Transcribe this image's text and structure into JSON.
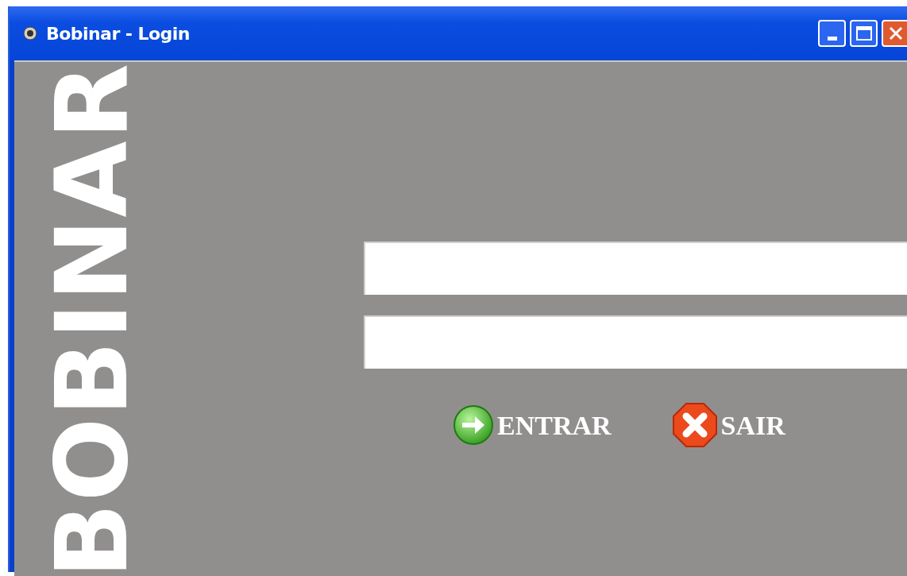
{
  "window": {
    "title": "Bobinar - Login"
  },
  "logo": {
    "text": "BOBINAR"
  },
  "buttons": [
    {
      "kind": "enter",
      "label": "ENTRAR"
    },
    {
      "kind": "exit",
      "label": "SAIR"
    }
  ]
}
